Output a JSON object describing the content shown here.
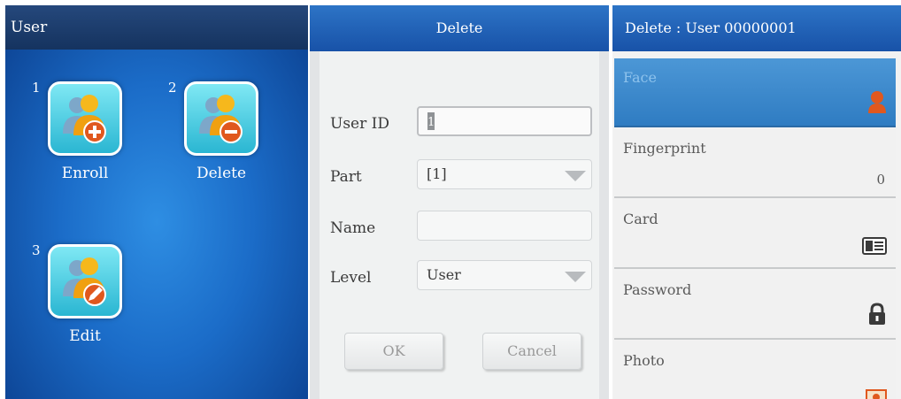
{
  "user_menu": {
    "title": "User",
    "items": [
      {
        "number": "1",
        "label": "Enroll",
        "icon": "add-user-icon"
      },
      {
        "number": "2",
        "label": "Delete",
        "icon": "remove-user-icon"
      },
      {
        "number": "3",
        "label": "Edit",
        "icon": "edit-user-icon"
      }
    ]
  },
  "delete_form": {
    "title": "Delete",
    "fields": [
      {
        "label": "User ID",
        "value": "1"
      },
      {
        "label": "Part",
        "value": "[1]"
      },
      {
        "label": "Name",
        "value": ""
      },
      {
        "label": "Level",
        "value": "User"
      }
    ],
    "ok_label": "OK",
    "cancel_label": "Cancel"
  },
  "delete_options": {
    "title": "Delete : User 00000001",
    "items": [
      {
        "label": "Face",
        "value": "",
        "icon": "face-icon",
        "selected": true
      },
      {
        "label": "Fingerprint",
        "value": "0",
        "icon": ""
      },
      {
        "label": "Card",
        "value": "",
        "icon": "card-icon"
      },
      {
        "label": "Password",
        "value": "",
        "icon": "lock-icon"
      },
      {
        "label": "Photo",
        "value": "",
        "icon": "photo-icon"
      }
    ]
  },
  "colors": {
    "title_blue": "#1f5fb4",
    "menu_background": "#1b6cc8",
    "tile_teal": "#2ab6d2",
    "selected_row": "#3a86c9",
    "icon_orange": "#e0581e"
  }
}
